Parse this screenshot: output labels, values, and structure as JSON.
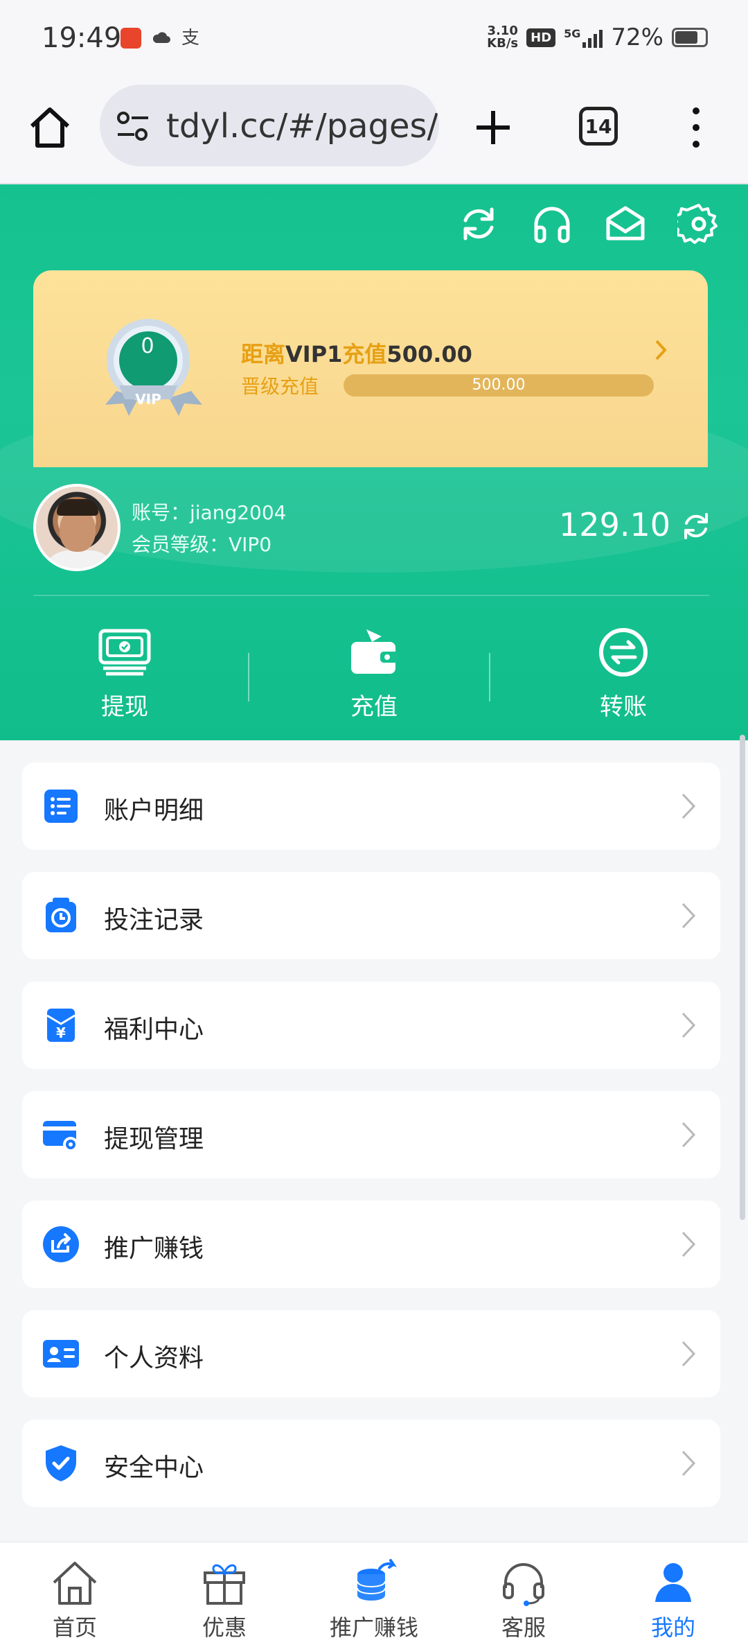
{
  "status_bar": {
    "time": "19:49",
    "network_speed": "3.10\nKB/s",
    "hd": "HD",
    "signal": "5G",
    "battery": "72%"
  },
  "browser": {
    "url": "tdyl.cc/#/pages/m",
    "tab_count": "14"
  },
  "header_icons": [
    "refresh-icon",
    "headset-icon",
    "mail-icon",
    "settings-icon"
  ],
  "vip": {
    "badge_number": "0",
    "badge_text": "VIP",
    "title_prefix": "距离",
    "title_level": "VIP1",
    "title_mid": "充值",
    "title_amount": "500.00",
    "subtitle": "晋级充值",
    "progress_text": "500.00",
    "progress_fraction": 0.0
  },
  "user": {
    "account_label": "账号：jiang2004",
    "level_label": "会员等级：VIP0",
    "balance": "129.10"
  },
  "actions": [
    {
      "label": "提现",
      "icon": "withdraw-icon"
    },
    {
      "label": "充值",
      "icon": "wallet-icon"
    },
    {
      "label": "转账",
      "icon": "transfer-icon"
    }
  ],
  "menu": [
    {
      "label": "账户明细",
      "icon": "list-icon"
    },
    {
      "label": "投注记录",
      "icon": "clock-icon"
    },
    {
      "label": "福利中心",
      "icon": "yen-envelope-icon"
    },
    {
      "label": "提现管理",
      "icon": "card-gear-icon"
    },
    {
      "label": "推广赚钱",
      "icon": "share-icon"
    },
    {
      "label": "个人资料",
      "icon": "id-card-icon"
    },
    {
      "label": "安全中心",
      "icon": "shield-check-icon"
    }
  ],
  "bottom_nav": [
    {
      "label": "首页",
      "icon": "home-icon"
    },
    {
      "label": "优惠",
      "icon": "gift-icon"
    },
    {
      "label": "推广赚钱",
      "icon": "coins-icon"
    },
    {
      "label": "客服",
      "icon": "headset-icon"
    },
    {
      "label": "我的",
      "icon": "user-icon"
    }
  ],
  "colors": {
    "header_green": "#15c28f",
    "vip_gold": "#e7a014",
    "accent_blue": "#1677ff"
  }
}
